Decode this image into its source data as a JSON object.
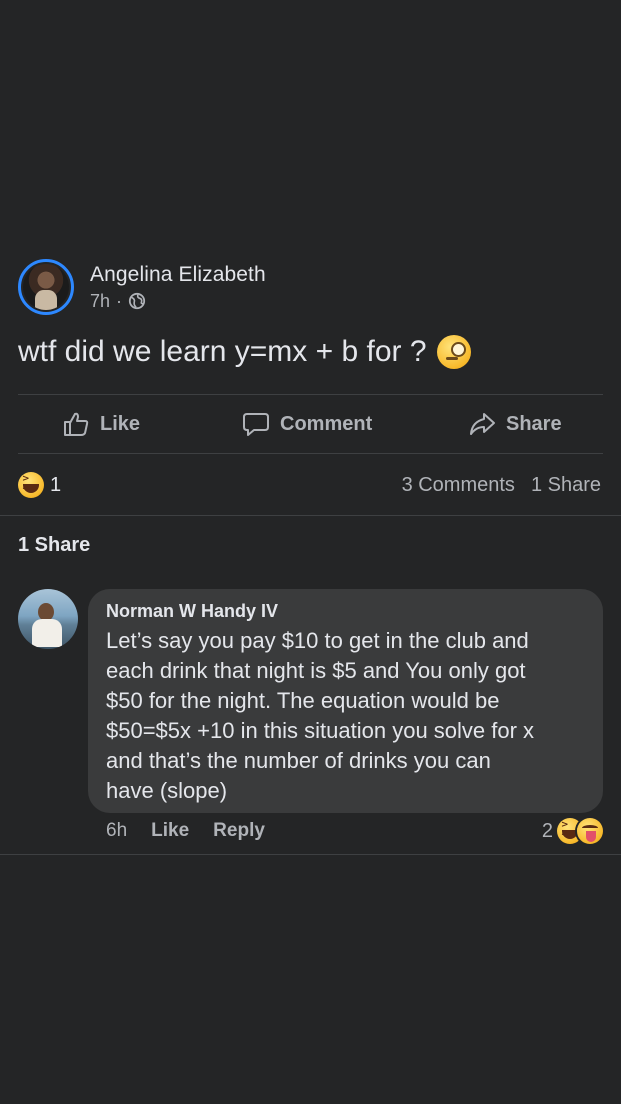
{
  "post": {
    "author": "Angelina Elizabeth",
    "time": "7h",
    "separator": "·",
    "privacy_icon": "globe-icon",
    "text": "wtf did we learn y=mx + b for ?",
    "emoji": "face-with-monocle"
  },
  "actions": {
    "like_label": "Like",
    "comment_label": "Comment",
    "share_label": "Share"
  },
  "stats": {
    "reaction_icon": "haha-emoji",
    "reaction_count": "1",
    "comments": "3 Comments",
    "shares": "1 Share"
  },
  "shares_section": {
    "heading": "1 Share"
  },
  "comment": {
    "author": "Norman W Handy IV",
    "text": "Let’s say you pay $10 to get in the club and\neach drink that night is $5 and You only got\n$50 for the night. The equation would be\n$50=$5x +10 in this situation you solve for x\nand that’s the number of drinks you can\nhave (slope)",
    "time": "6h",
    "like_label": "Like",
    "reply_label": "Reply",
    "reaction_count": "2",
    "reaction_icons": [
      "haha-emoji",
      "tongue-emoji"
    ]
  },
  "colors": {
    "background": "#242526",
    "bubble": "#3a3b3c",
    "avatar_ring": "#2d88ff",
    "primary_text": "#e4e6eb",
    "secondary_text": "#b0b3b8"
  }
}
